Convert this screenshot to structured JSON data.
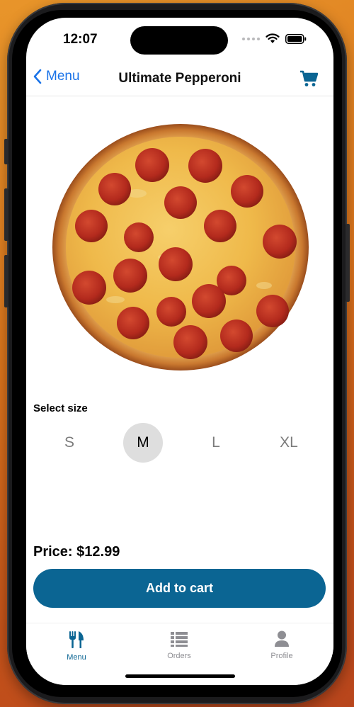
{
  "status": {
    "time": "12:07"
  },
  "nav": {
    "back_label": "Menu",
    "title": "Ultimate Pepperoni"
  },
  "product": {
    "size_heading": "Select size",
    "sizes": [
      "S",
      "M",
      "L",
      "XL"
    ],
    "selected_size": "M",
    "price_text": "Price: $12.99",
    "add_to_cart": "Add to cart"
  },
  "tabs": [
    {
      "label": "Menu",
      "icon": "utensils-icon",
      "active": true
    },
    {
      "label": "Orders",
      "icon": "list-icon",
      "active": false
    },
    {
      "label": "Profile",
      "icon": "user-icon",
      "active": false
    }
  ],
  "colors": {
    "accent": "#0b6593",
    "link": "#1a73e8",
    "selected_size_bg": "#dedede"
  }
}
